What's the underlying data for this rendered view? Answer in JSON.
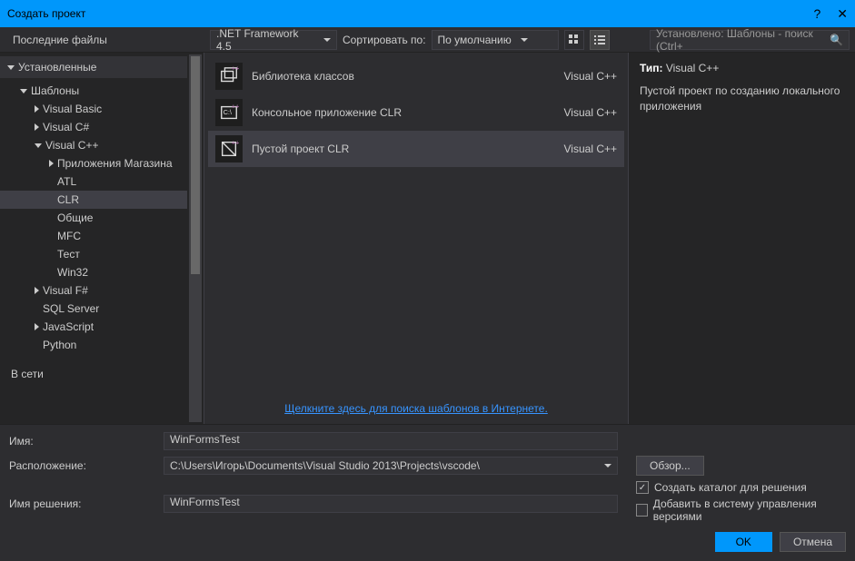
{
  "window": {
    "title": "Создать проект"
  },
  "toolbar": {
    "recent_header": "Последние файлы",
    "framework": ".NET Framework 4.5",
    "sort_label": "Сортировать по:",
    "sort_value": "По умолчанию",
    "search_placeholder": "Установлено: Шаблоны - поиск (Ctrl+"
  },
  "sidebar": {
    "installed_header": "Установленные",
    "online_header": "В сети",
    "tree": {
      "templates": "Шаблоны",
      "visual_basic": "Visual Basic",
      "visual_csharp": "Visual C#",
      "visual_cpp": "Visual C++",
      "store_apps": "Приложения Магазина",
      "atl": "ATL",
      "clr": "CLR",
      "general": "Общие",
      "mfc": "MFC",
      "test": "Тест",
      "win32": "Win32",
      "visual_fsharp": "Visual F#",
      "sql_server": "SQL Server",
      "javascript": "JavaScript",
      "python": "Python"
    }
  },
  "templates": {
    "items": [
      {
        "name": "Библиотека классов",
        "lang": "Visual C++"
      },
      {
        "name": "Консольное приложение CLR",
        "lang": "Visual C++"
      },
      {
        "name": "Пустой проект CLR",
        "lang": "Visual C++"
      }
    ],
    "online_link": "Щелкните здесь для поиска шаблонов в Интернете."
  },
  "details": {
    "type_label": "Тип:",
    "type_value": "Visual C++",
    "description": "Пустой проект по созданию локального приложения"
  },
  "form": {
    "name_label": "Имя:",
    "name_value": "WinFormsTest",
    "location_label": "Расположение:",
    "location_value": "C:\\Users\\Игорь\\Documents\\Visual Studio 2013\\Projects\\vscode\\",
    "solution_label": "Имя решения:",
    "solution_value": "WinFormsTest",
    "browse_button": "Обзор...",
    "create_dir_checkbox": "Создать каталог для решения",
    "add_source_control_checkbox": "Добавить в систему управления версиями",
    "ok_button": "OK",
    "cancel_button": "Отмена"
  }
}
